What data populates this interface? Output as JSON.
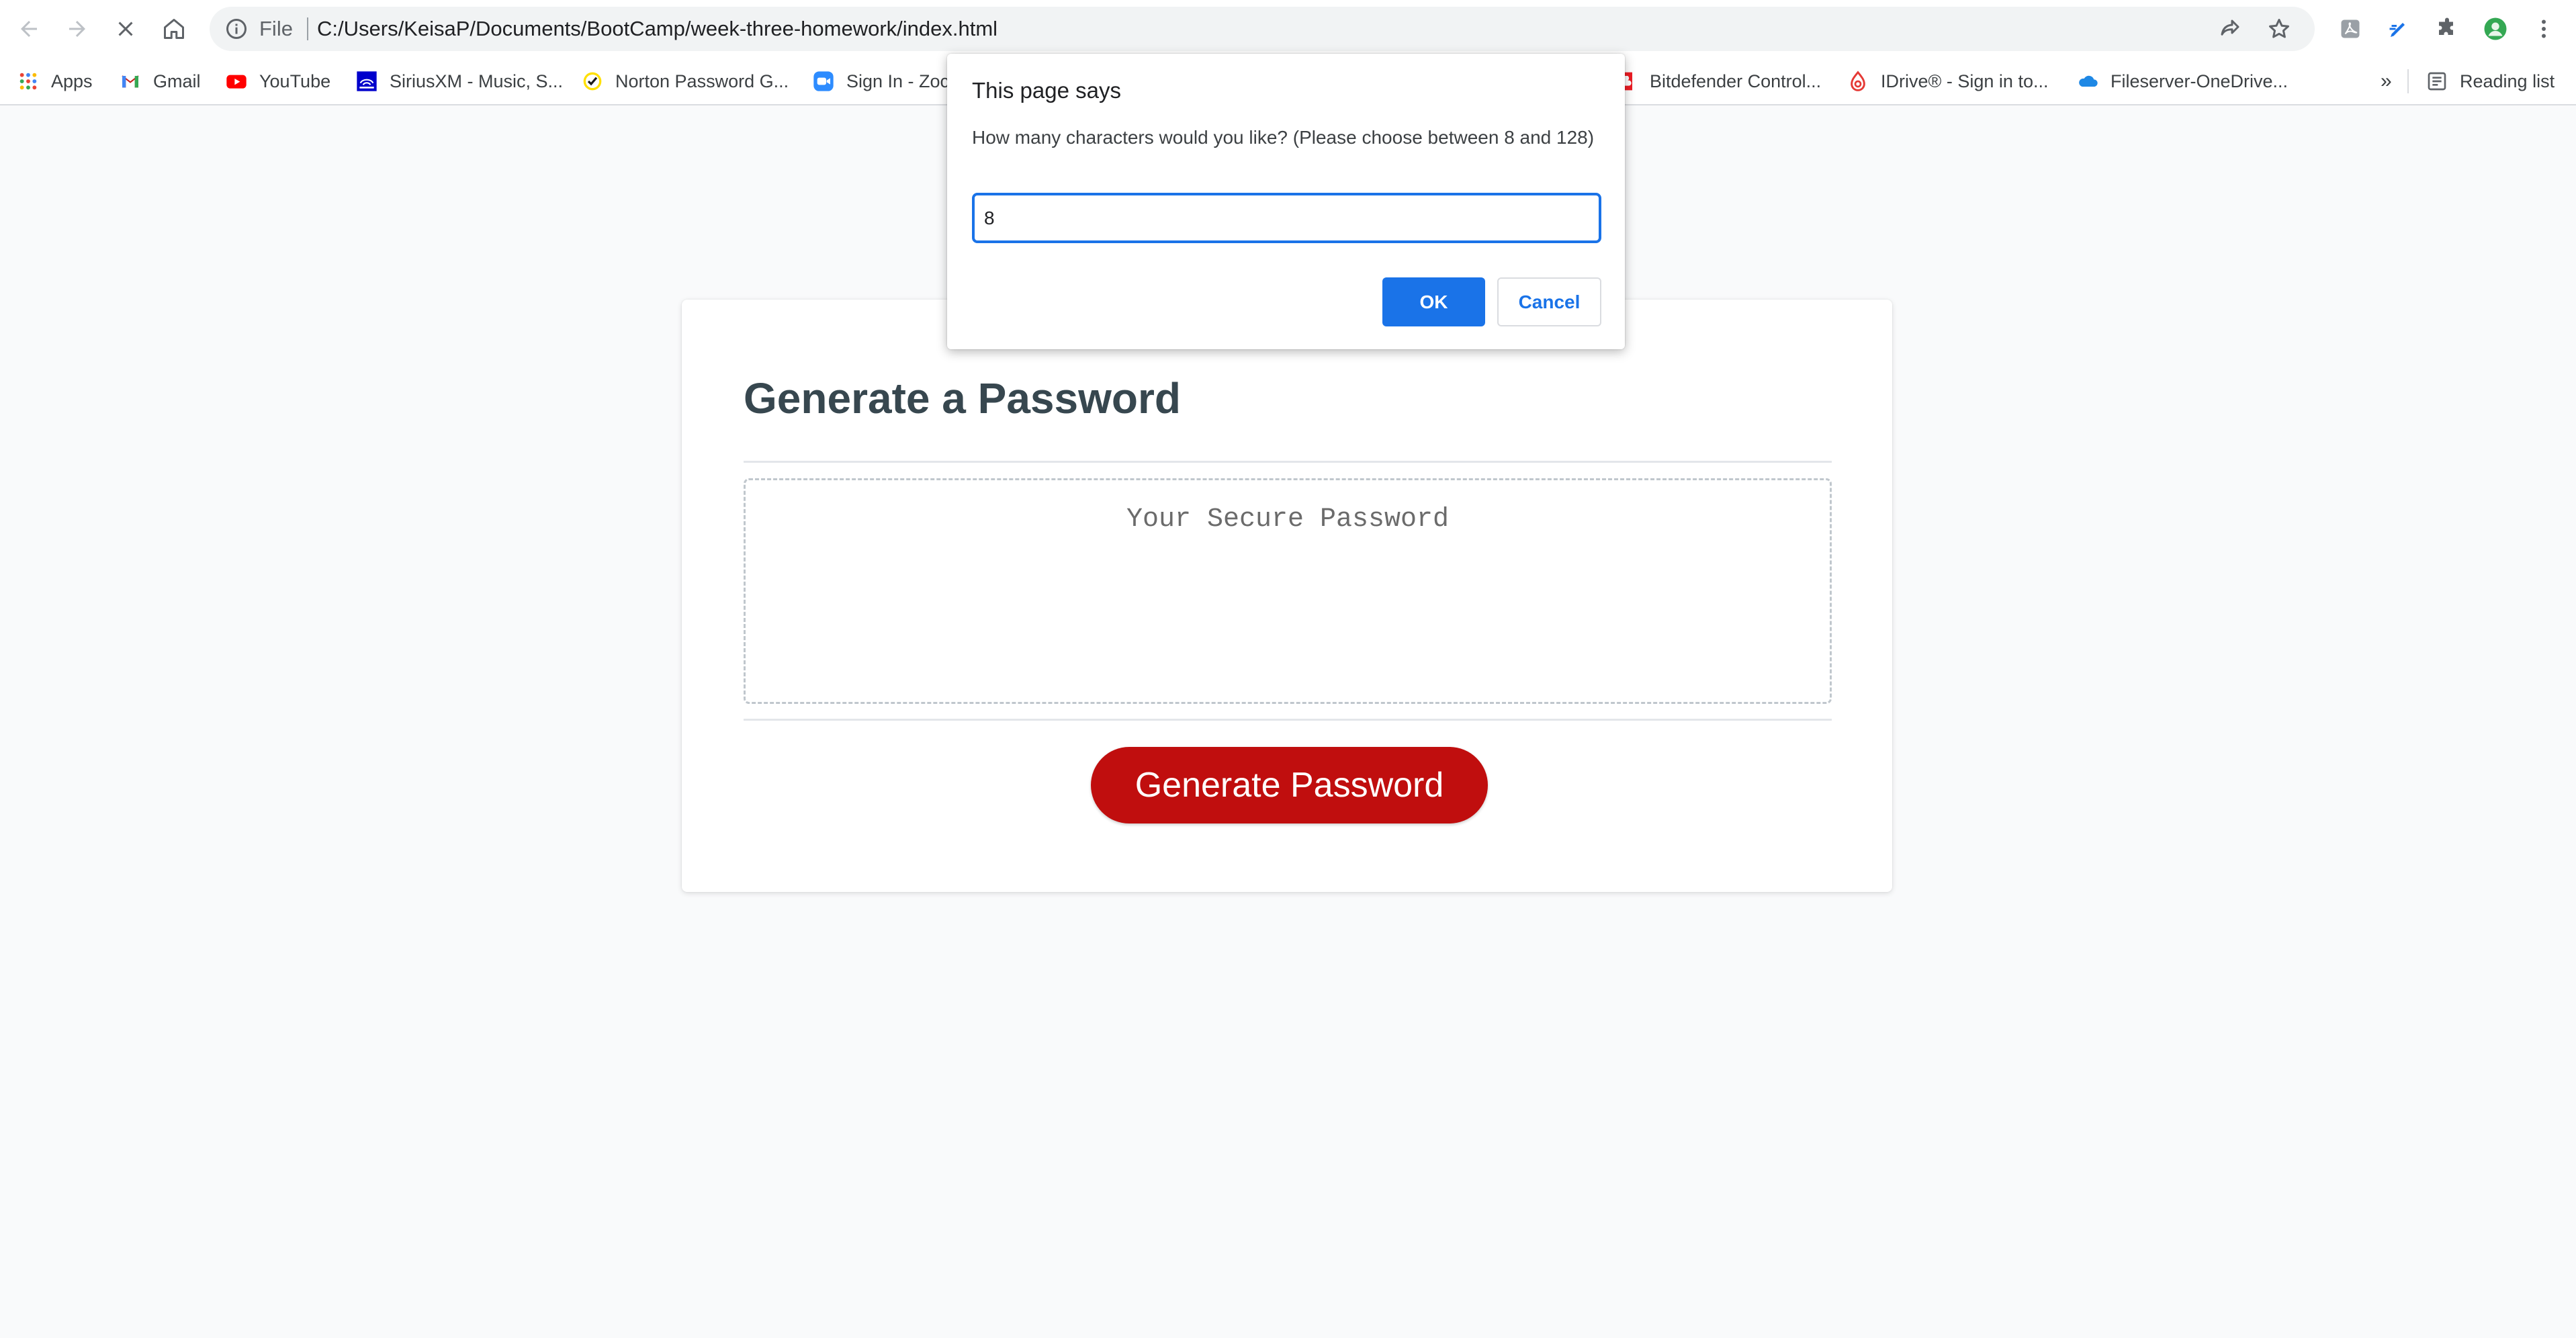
{
  "browser": {
    "address_scheme": "File",
    "address_url": "C:/Users/KeisaP/Documents/BootCamp/week-three-homework/index.html"
  },
  "bookmarks": {
    "items": [
      {
        "label": "Apps",
        "icon": "apps-grid-icon"
      },
      {
        "label": "Gmail",
        "icon": "gmail-icon"
      },
      {
        "label": "YouTube",
        "icon": "youtube-icon"
      },
      {
        "label": "SiriusXM - Music, S...",
        "icon": "siriusxm-icon"
      },
      {
        "label": "Norton Password G...",
        "icon": "norton-icon"
      },
      {
        "label": "Sign In - Zoc",
        "icon": "zoom-icon"
      },
      {
        "label": "Bitdefender Control...",
        "icon": "bitdefender-icon"
      },
      {
        "label": "IDrive® - Sign in to...",
        "icon": "idrive-icon"
      },
      {
        "label": "Fileserver-OneDrive...",
        "icon": "onedrive-icon"
      }
    ],
    "overflow": "»",
    "reading_list": "Reading list"
  },
  "page": {
    "title": "Generate a Password",
    "password_placeholder": "Your Secure Password",
    "generate_button": "Generate Password"
  },
  "dialog": {
    "title": "This page says",
    "message": "How many characters would you like? (Please choose between 8 and 128)",
    "input_value": "8",
    "ok_label": "OK",
    "cancel_label": "Cancel"
  },
  "colors": {
    "accent_blue": "#1a73e8",
    "generate_button_red": "#c00e0e",
    "title_text": "#37474f",
    "page_background": "#f9fafb"
  }
}
